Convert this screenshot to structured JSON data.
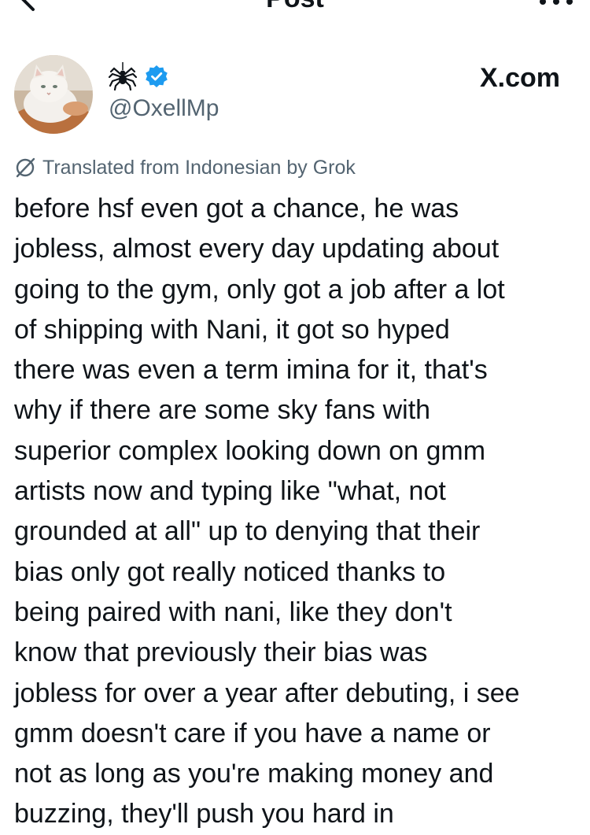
{
  "header": {
    "title": "Post",
    "back_icon": "arrow-left-icon",
    "more_icon": "more-horizontal-icon"
  },
  "author": {
    "avatar": "white-cat-avatar",
    "display_name_icon": "spider-icon",
    "verified_icon": "verified-badge-icon",
    "handle": "@OxellMp"
  },
  "watermark": "X.com",
  "translation": {
    "icon": "no-translate-icon",
    "label": "Translated from Indonesian by Grok"
  },
  "post": {
    "lines": [
      "before hsf even got a chance, he was",
      "jobless, almost every day updating about",
      "going to the gym, only got a job after a lot",
      "of shipping with Nani, it got so hyped",
      "there was even a term imina for it, that's",
      "why if there are some sky fans with",
      "superior complex looking down on gmm",
      "artists now and typing like \"what, not",
      "grounded at all\" up to denying that their",
      "bias only got really noticed thanks to",
      "being paired with nani, like they don't",
      "know that previously their bias was",
      "jobless for over a year after debuting, i see",
      "gmm doesn't care if you have a name or",
      "not as long as you're making money and",
      "buzzing, they'll push you hard in"
    ]
  },
  "colors": {
    "text": "#0f1419",
    "secondary_text": "#536471",
    "verified_blue": "#1d9bf0",
    "background": "#ffffff"
  }
}
